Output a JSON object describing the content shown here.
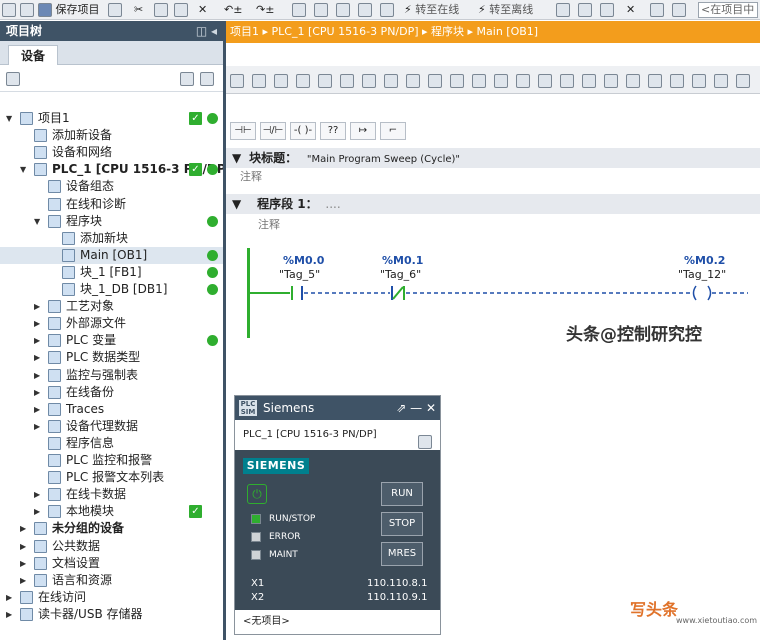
{
  "toolbar": {
    "save_project": "保存项目",
    "go_online": "转至在线",
    "go_offline": "转至离线",
    "search_placeholder": "<在项目中"
  },
  "project_tree": {
    "title": "项目树",
    "devices_tab": "设备",
    "items": [
      {
        "label": "项目1",
        "icon": "project-icon",
        "level": 0,
        "arrow": "▼",
        "check": true,
        "dot": true
      },
      {
        "label": "添加新设备",
        "icon": "add-device-icon",
        "level": 1
      },
      {
        "label": "设备和网络",
        "icon": "network-icon",
        "level": 1
      },
      {
        "label": "PLC_1 [CPU 1516-3 PN/DP]",
        "icon": "plc-icon",
        "level": 1,
        "arrow": "▼",
        "check": true,
        "dot": true,
        "bold": true
      },
      {
        "label": "设备组态",
        "icon": "config-icon",
        "level": 2
      },
      {
        "label": "在线和诊断",
        "icon": "diagnostics-icon",
        "level": 2
      },
      {
        "label": "程序块",
        "icon": "folder-icon",
        "level": 2,
        "arrow": "▼",
        "dot": true
      },
      {
        "label": "添加新块",
        "icon": "add-block-icon",
        "level": 3
      },
      {
        "label": "Main [OB1]",
        "icon": "ob-icon",
        "level": 3,
        "dot": true,
        "selected": true
      },
      {
        "label": "块_1 [FB1]",
        "icon": "fb-icon",
        "level": 3,
        "dot": true
      },
      {
        "label": "块_1_DB [DB1]",
        "icon": "db-icon",
        "level": 3,
        "dot": true
      },
      {
        "label": "工艺对象",
        "icon": "folder-icon",
        "level": 2,
        "arrow": "▶"
      },
      {
        "label": "外部源文件",
        "icon": "folder-icon",
        "level": 2,
        "arrow": "▶"
      },
      {
        "label": "PLC 变量",
        "icon": "folder-icon",
        "level": 2,
        "arrow": "▶",
        "dot": true
      },
      {
        "label": "PLC 数据类型",
        "icon": "folder-icon",
        "level": 2,
        "arrow": "▶"
      },
      {
        "label": "监控与强制表",
        "icon": "folder-icon",
        "level": 2,
        "arrow": "▶"
      },
      {
        "label": "在线备份",
        "icon": "folder-icon",
        "level": 2,
        "arrow": "▶"
      },
      {
        "label": "Traces",
        "icon": "folder-icon",
        "level": 2,
        "arrow": "▶"
      },
      {
        "label": "设备代理数据",
        "icon": "folder-icon",
        "level": 2,
        "arrow": "▶"
      },
      {
        "label": "程序信息",
        "icon": "info-icon",
        "level": 2
      },
      {
        "label": "PLC 监控和报警",
        "icon": "alarm-icon",
        "level": 2
      },
      {
        "label": "PLC 报警文本列表",
        "icon": "list-icon",
        "level": 2
      },
      {
        "label": "在线卡数据",
        "icon": "folder-icon",
        "level": 2,
        "arrow": "▶"
      },
      {
        "label": "本地模块",
        "icon": "folder-icon",
        "level": 2,
        "arrow": "▶",
        "check": true
      },
      {
        "label": "未分组的设备",
        "icon": "folder-icon",
        "level": 1,
        "arrow": "▶",
        "bold": true
      },
      {
        "label": "公共数据",
        "icon": "folder-icon",
        "level": 1,
        "arrow": "▶"
      },
      {
        "label": "文档设置",
        "icon": "folder-icon",
        "level": 1,
        "arrow": "▶"
      },
      {
        "label": "语言和资源",
        "icon": "folder-icon",
        "level": 1,
        "arrow": "▶"
      },
      {
        "label": "在线访问",
        "icon": "online-icon",
        "level": 0,
        "arrow": "▶"
      },
      {
        "label": "读卡器/USB 存储器",
        "icon": "usb-icon",
        "level": 0,
        "arrow": "▶"
      }
    ]
  },
  "editor": {
    "breadcrumb": "项目1  ▸  PLC_1 [CPU 1516-3 PN/DP]  ▸  程序块  ▸  Main [OB1]",
    "block_title_label": "块标题：",
    "block_title_value": "\"Main Program Sweep (Cycle)\"",
    "block_comment": "注释",
    "network_label": "程序段 1：",
    "network_dots": "....",
    "network_comment": "注释",
    "contacts": [
      {
        "address": "%M0.0",
        "tag": "\"Tag_5\""
      },
      {
        "address": "%M0.1",
        "tag": "\"Tag_6\""
      },
      {
        "address": "%M0.2",
        "tag": "\"Tag_12\""
      }
    ]
  },
  "watermark": "头条@控制研究控",
  "simulator": {
    "title": "Siemens",
    "device": "PLC_1 [CPU 1516-3 PN/DP]",
    "brand": "SIEMENS",
    "leds": [
      {
        "label": "RUN/STOP",
        "color": "#2fae2f"
      },
      {
        "label": "ERROR",
        "color": "#cfd3d6"
      },
      {
        "label": "MAINT",
        "color": "#cfd3d6"
      }
    ],
    "buttons": {
      "run": "RUN",
      "stop": "STOP",
      "mres": "MRES"
    },
    "interfaces": [
      {
        "name": "X1",
        "ip": "110.110.8.1"
      },
      {
        "name": "X2",
        "ip": "110.110.9.1"
      }
    ],
    "footer": "<无项目>"
  },
  "corner_brand": {
    "text": "写头条",
    "url": "www.xietoutiao.com"
  },
  "colors": {
    "accent": "#f39d1c",
    "header": "#3f5366",
    "ok": "#2fae2f",
    "siemens": "#00808e"
  }
}
